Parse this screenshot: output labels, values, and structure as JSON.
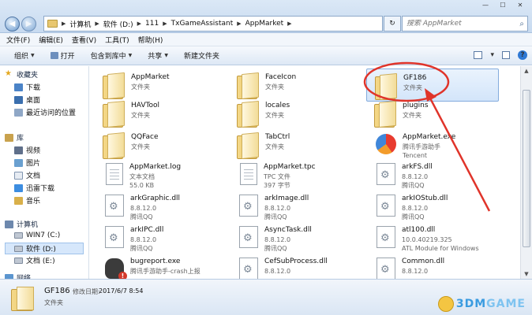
{
  "address": {
    "crumbs": [
      "计算机",
      "软件 (D:)",
      "111",
      "TxGameAssistant",
      "AppMarket"
    ]
  },
  "search": {
    "placeholder": "搜索 AppMarket"
  },
  "menu": [
    "文件(F)",
    "编辑(E)",
    "查看(V)",
    "工具(T)",
    "帮助(H)"
  ],
  "toolbar": {
    "organize": "组织",
    "open": "打开",
    "include": "包含到库中",
    "share": "共享",
    "new_folder": "新建文件夹"
  },
  "sidebar": {
    "favorites": "收藏夹",
    "fav_items": [
      "下载",
      "桌面",
      "最近访问的位置"
    ],
    "libraries": "库",
    "lib_items": [
      "视频",
      "图片",
      "文档",
      "迅雷下载",
      "音乐"
    ],
    "computer": "计算机",
    "pc_items": [
      "WIN7 (C:)",
      "软件 (D:)",
      "文档 (E:)"
    ],
    "network": "网络"
  },
  "files": [
    {
      "name": "AppMarket",
      "l1": "文件夹",
      "l2": "",
      "kind": "folder"
    },
    {
      "name": "FaceIcon",
      "l1": "文件夹",
      "l2": "",
      "kind": "folder"
    },
    {
      "name": "GF186",
      "l1": "文件夹",
      "l2": "",
      "kind": "folder",
      "selected": true
    },
    {
      "name": "HAVTool",
      "l1": "文件夹",
      "l2": "",
      "kind": "folder"
    },
    {
      "name": "locales",
      "l1": "文件夹",
      "l2": "",
      "kind": "folder"
    },
    {
      "name": "plugins",
      "l1": "文件夹",
      "l2": "",
      "kind": "folder"
    },
    {
      "name": "QQFace",
      "l1": "文件夹",
      "l2": "",
      "kind": "folder"
    },
    {
      "name": "TabCtrl",
      "l1": "文件夹",
      "l2": "",
      "kind": "folder"
    },
    {
      "name": "AppMarket.exe",
      "l1": "腾讯手游助手",
      "l2": "Tencent",
      "kind": "exe"
    },
    {
      "name": "AppMarket.log",
      "l1": "文本文档",
      "l2": "55.0 KB",
      "kind": "doc"
    },
    {
      "name": "AppMarket.tpc",
      "l1": "TPC 文件",
      "l2": "397 字节",
      "kind": "doc"
    },
    {
      "name": "arkFS.dll",
      "l1": "8.8.12.0",
      "l2": "腾讯QQ",
      "kind": "dll"
    },
    {
      "name": "arkGraphic.dll",
      "l1": "8.8.12.0",
      "l2": "腾讯QQ",
      "kind": "dll"
    },
    {
      "name": "arkImage.dll",
      "l1": "8.8.12.0",
      "l2": "腾讯QQ",
      "kind": "dll"
    },
    {
      "name": "arkIOStub.dll",
      "l1": "8.8.12.0",
      "l2": "腾讯QQ",
      "kind": "dll"
    },
    {
      "name": "arkIPC.dll",
      "l1": "8.8.12.0",
      "l2": "腾讯QQ",
      "kind": "dll"
    },
    {
      "name": "AsyncTask.dll",
      "l1": "8.8.12.0",
      "l2": "腾讯QQ",
      "kind": "dll"
    },
    {
      "name": "atl100.dll",
      "l1": "10.0.40219.325",
      "l2": "ATL Module for Windows",
      "kind": "dll"
    },
    {
      "name": "bugreport.exe",
      "l1": "腾讯手游助手-crash上报",
      "l2": "",
      "kind": "bug"
    },
    {
      "name": "CefSubProcess.dll",
      "l1": "8.8.12.0",
      "l2": "",
      "kind": "dll"
    },
    {
      "name": "Common.dll",
      "l1": "8.8.12.0",
      "l2": "",
      "kind": "dll"
    }
  ],
  "details": {
    "name": "GF186",
    "modified_label": "修改日期:",
    "modified_value": "2017/6/7 8:54",
    "type": "文件夹"
  },
  "watermark": {
    "pre": "3DM",
    "post": "GAME"
  },
  "colors": {
    "annotation": "#e0342a",
    "selection": "#d3e5fa"
  }
}
